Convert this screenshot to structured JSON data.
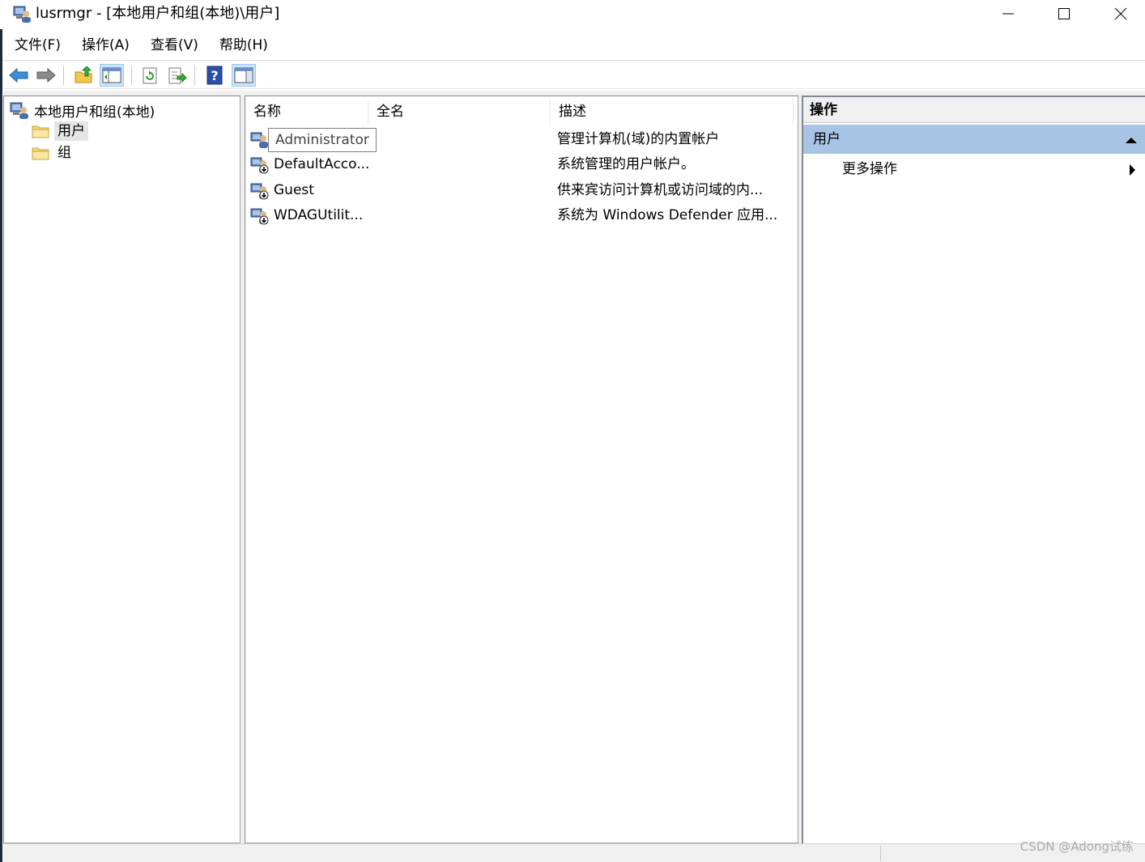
{
  "window": {
    "title": "lusrmgr - [本地用户和组(本地)\\用户]"
  },
  "menu": [
    "文件(F)",
    "操作(A)",
    "查看(V)",
    "帮助(H)"
  ],
  "toolbar": {
    "buttons": [
      "back-icon",
      "forward-icon",
      "up-folder-icon",
      "show-hide-tree-icon",
      "refresh-icon",
      "export-list-icon",
      "help-icon",
      "show-hide-action-pane-icon"
    ]
  },
  "tree": {
    "root": "本地用户和组(本地)",
    "children": [
      {
        "label": "用户",
        "selected": true
      },
      {
        "label": "组",
        "selected": false
      }
    ]
  },
  "list": {
    "columns": [
      "名称",
      "全名",
      "描述"
    ],
    "rows": [
      {
        "name": "Administrator",
        "fullname": "",
        "description": "管理计算机(域)的内置帐户"
      },
      {
        "name": "DefaultAcco...",
        "fullname": "",
        "description": "系统管理的用户帐户。"
      },
      {
        "name": "Guest",
        "fullname": "",
        "description": "供来宾访问计算机或访问域的内..."
      },
      {
        "name": "WDAGUtilit...",
        "fullname": "",
        "description": "系统为 Windows Defender 应用..."
      }
    ]
  },
  "actions": {
    "title": "操作",
    "section": "用户",
    "more": "更多操作"
  },
  "watermark": "CSDN @Adong试练",
  "colors": {
    "action_section_bg": "#a7c4e4",
    "selected_tree_bg": "#e5e5e5",
    "pressed_button_bg": "#cce4f7"
  }
}
